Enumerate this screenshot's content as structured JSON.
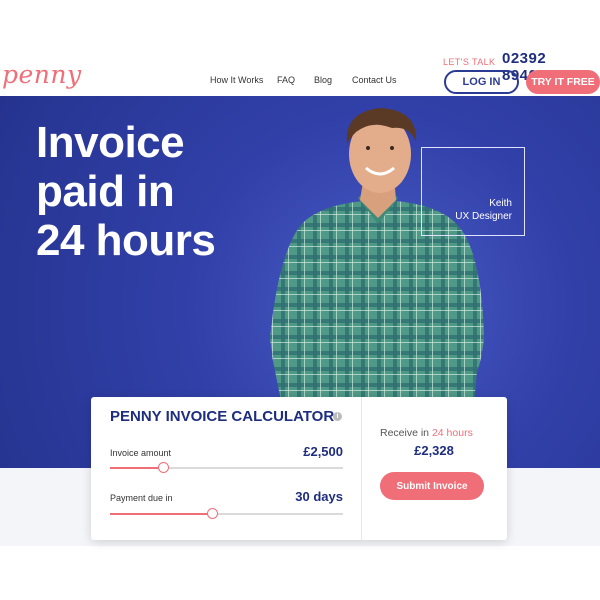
{
  "brand": {
    "logo_text": "penny",
    "accent_color": "#ef6e78",
    "primary_color": "#1f2d7f"
  },
  "nav": {
    "items": [
      "How It Works",
      "FAQ",
      "Blog",
      "Contact Us"
    ]
  },
  "contact": {
    "lets_talk": "LET'S TALK",
    "phone": "02392 894000"
  },
  "auth": {
    "login_label": "LOG IN",
    "try_label": "TRY IT FREE"
  },
  "hero": {
    "headline": [
      "Invoice",
      "paid in",
      "24 hours"
    ],
    "person": {
      "name": "Keith",
      "role": "UX Designer"
    }
  },
  "calculator": {
    "title": "PENNY INVOICE CALCULATOR",
    "info_icon": "info-icon",
    "invoice_amount": {
      "label": "Invoice amount",
      "value": "£2,500",
      "slider_fraction": 0.23
    },
    "payment_due": {
      "label": "Payment due in",
      "value": "30 days",
      "slider_fraction": 0.44
    },
    "receive": {
      "prefix": "Receive in ",
      "highlight": "24 hours",
      "amount": "£2,328"
    },
    "submit_label": "Submit Invoice"
  }
}
